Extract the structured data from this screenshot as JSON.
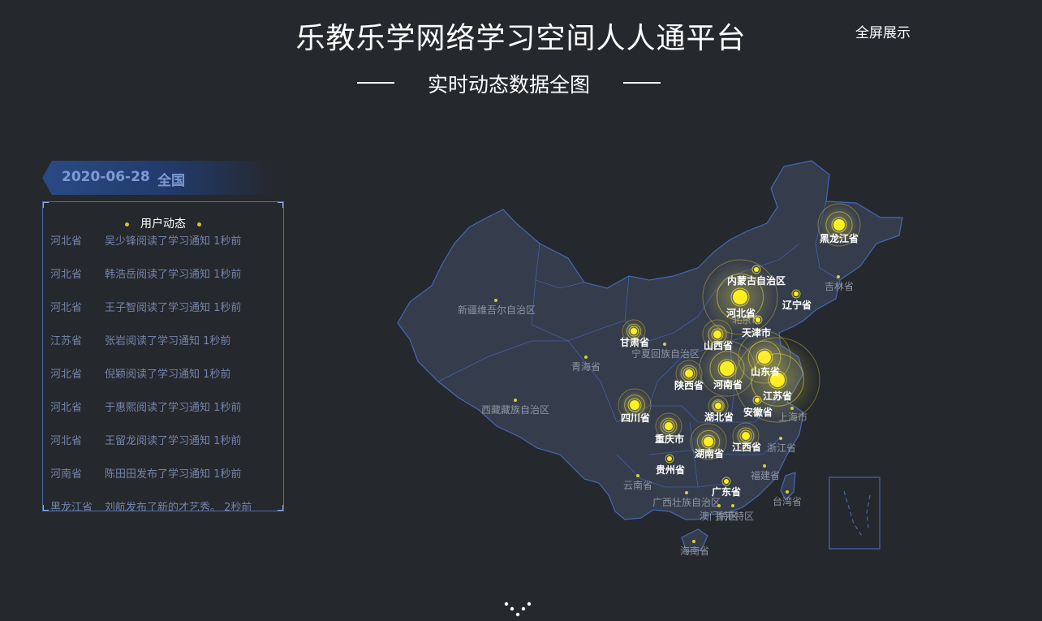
{
  "header": {
    "title": "乐教乐学网络学习空间人人通平台",
    "subtitle": "实时动态数据全图",
    "fullscreen_label": "全屏展示"
  },
  "filter": {
    "date": "2020-06-28",
    "region": "全国"
  },
  "feed": {
    "title": "用户动态",
    "items": [
      {
        "province": "河北省",
        "text": "吴少锋阅读了学习通知 1秒前"
      },
      {
        "province": "河北省",
        "text": "韩浩岳阅读了学习通知 1秒前"
      },
      {
        "province": "河北省",
        "text": "王子智阅读了学习通知 1秒前"
      },
      {
        "province": "江苏省",
        "text": "张岩阅读了学习通知 1秒前"
      },
      {
        "province": "河北省",
        "text": "倪颖阅读了学习通知 1秒前"
      },
      {
        "province": "河北省",
        "text": "于惠熙阅读了学习通知 1秒前"
      },
      {
        "province": "河北省",
        "text": "王留龙阅读了学习通知 1秒前"
      },
      {
        "province": "河南省",
        "text": "陈田田发布了学习通知 1秒前"
      },
      {
        "province": "黑龙江省",
        "text": "刘航发布了新的才艺秀。 2秒前"
      }
    ]
  },
  "map": {
    "colors": {
      "land": "#353c4b",
      "border": "#4468b8",
      "active": "#ffee22",
      "inactive_dot": "#d9cf3a"
    },
    "active_provinces": [
      "黑龙江省",
      "内蒙古自治区",
      "辽宁省",
      "河北省",
      "天津市",
      "甘肃省",
      "山西省",
      "山东省",
      "陕西省",
      "河南省",
      "江苏省",
      "四川省",
      "湖北省",
      "安徽省",
      "重庆市",
      "湖南省",
      "江西省",
      "贵州省",
      "广东省"
    ],
    "inactive_provinces": [
      "吉林省",
      "北京市",
      "新疆维吾尔自治区",
      "青海省",
      "宁夏回族自治区",
      "西藏藏族自治区",
      "上海市",
      "浙江省",
      "福建省",
      "云南省",
      "广西壮族自治区",
      "台湾省",
      "澳门特区",
      "香港特区",
      "海南省"
    ]
  }
}
